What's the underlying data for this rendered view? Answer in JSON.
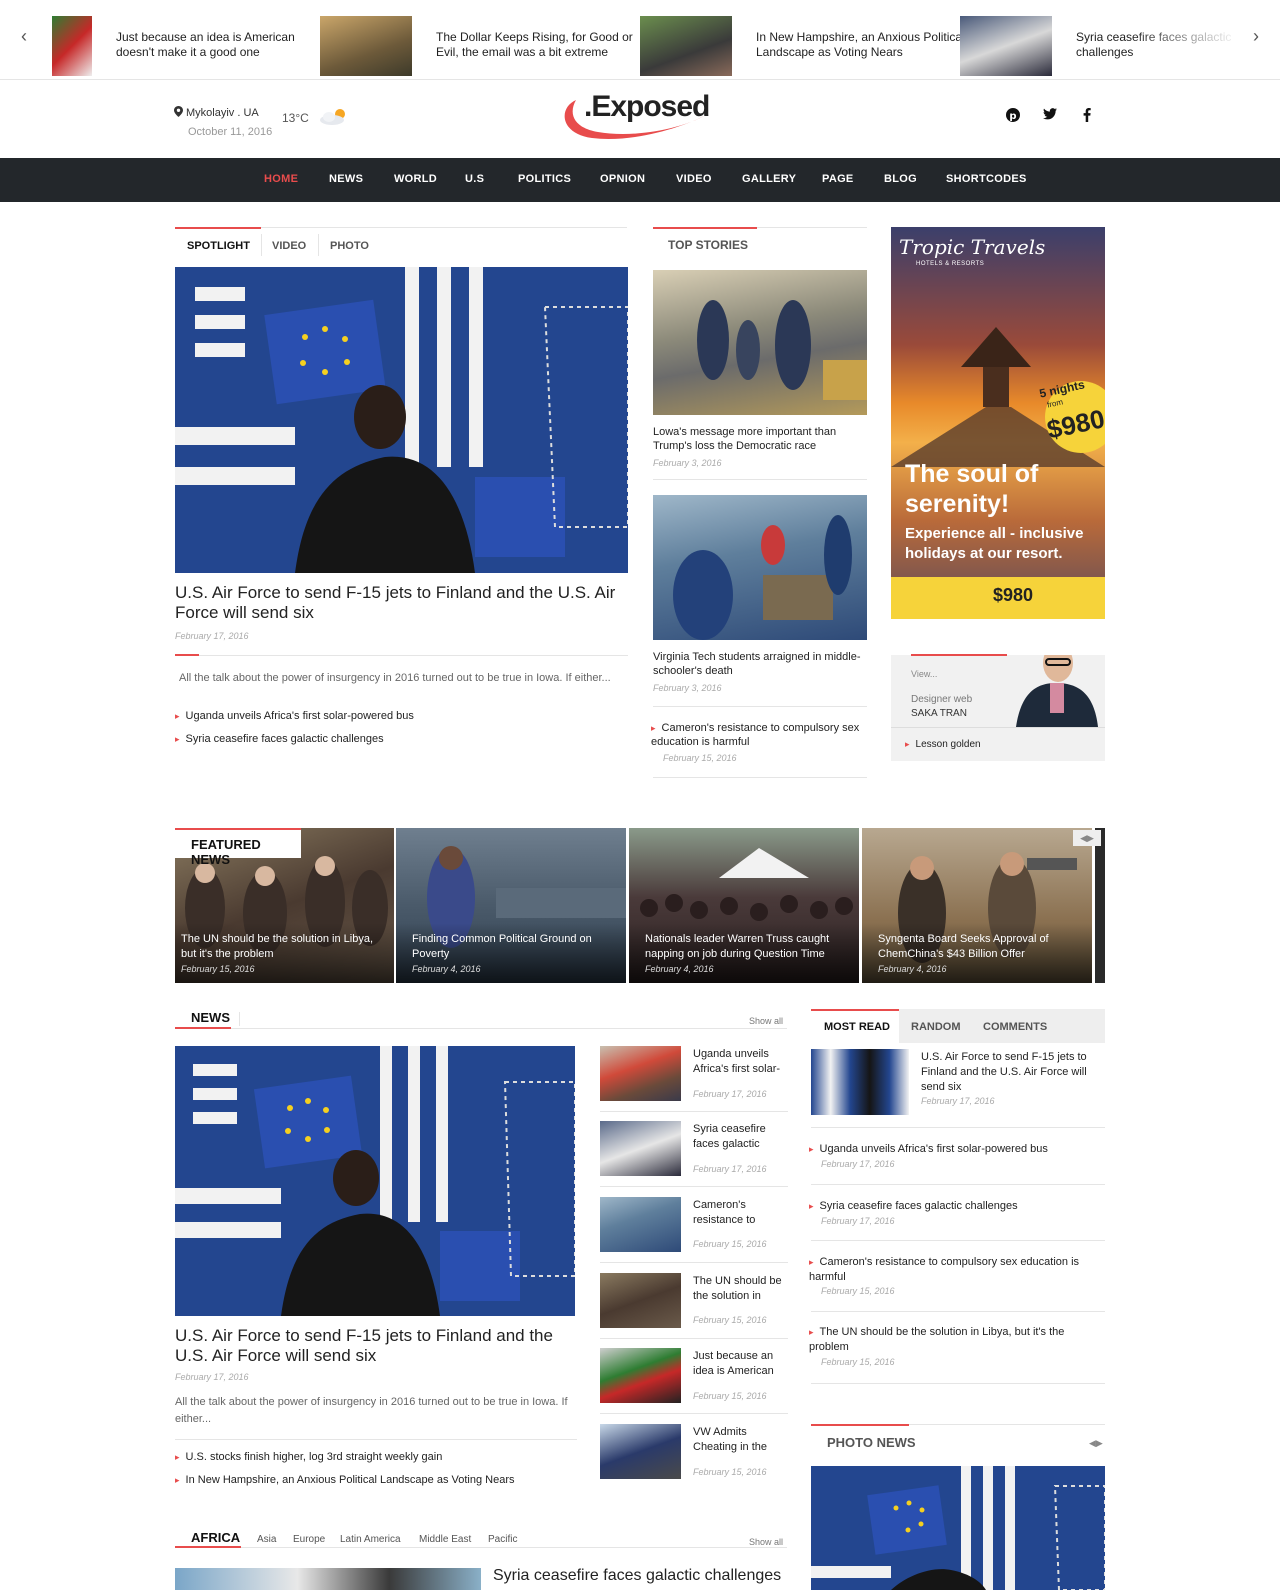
{
  "ticker": {
    "items": [
      {
        "text": "Just because an idea is American doesn't make it a good one"
      },
      {
        "text": "The Dollar Keeps Rising, for Good or Evil, the email was a bit extreme"
      },
      {
        "text": "In New Hampshire, an Anxious Political Landscape as Voting Nears"
      },
      {
        "text": "Syria ceasefire faces galactic challenges"
      }
    ]
  },
  "header": {
    "location": "Mykolayiv . UA",
    "date": "October 11, 2016",
    "temperature": "13°C",
    "logo": ".Exposed",
    "social": [
      "P",
      "t",
      "f"
    ]
  },
  "nav": {
    "items": [
      "HOME",
      "NEWS",
      "WORLD",
      "U.S",
      "POLITICS",
      "OPNION",
      "VIDEO",
      "GALLERY",
      "PAGE",
      "BLOG",
      "SHORTCODES"
    ]
  },
  "spotlight": {
    "tabs": [
      "SPOTLIGHT",
      "VIDEO",
      "PHOTO"
    ],
    "title": "U.S. Air Force to send F-15 jets to Finland and the U.S. Air Force will send six",
    "date": "February 17, 2016",
    "excerpt": "All the talk about the power of insurgency in 2016 turned out to be true in Iowa. If either...",
    "links": [
      "Uganda unveils Africa's first solar-powered bus",
      "Syria ceasefire faces galactic challenges"
    ]
  },
  "top_stories": {
    "heading": "TOP STORIES",
    "items": [
      {
        "title": "Lowa's message more important than Trump's loss the Democratic race",
        "date": "February 3, 2016"
      },
      {
        "title": "Virginia Tech students arraigned in middle-schooler's death",
        "date": "February 3, 2016"
      },
      {
        "title": "Cameron's resistance to compulsory sex education is harmful",
        "date": "February 15, 2016"
      }
    ]
  },
  "ad": {
    "brand": "Tropic Travels",
    "brand_sub": "HOTELS & RESORTS",
    "nights": "5 nights",
    "from": "from",
    "price": "$980",
    "headline": "The soul of serenity!",
    "sub": "Experience all - inclusive holidays at our resort.",
    "footer_price": "$980"
  },
  "profile": {
    "view": "View...",
    "role": "Designer web",
    "name": "SAKA TRAN",
    "link": "Lesson golden"
  },
  "featured": {
    "heading": "FEATURED NEWS",
    "items": [
      {
        "title": "The UN should be the solution in Libya, but it's the problem",
        "date": "February 15, 2016"
      },
      {
        "title": "Finding Common Political Ground on Poverty",
        "date": "February 4, 2016"
      },
      {
        "title": "Nationals leader Warren Truss caught napping on job during Question Time",
        "date": "February 4, 2016"
      },
      {
        "title": "Syngenta Board Seeks Approval of ChemChina's $43 Billion Offer",
        "date": "February 4, 2016"
      }
    ]
  },
  "news": {
    "heading": "NEWS",
    "show_all": "Show all",
    "title": "U.S. Air Force to send F-15 jets to Finland and the U.S. Air Force will send six",
    "date": "February 17, 2016",
    "excerpt": "All the talk about the power of insurgency in 2016 turned out to be true in Iowa. If either...",
    "links": [
      "U.S. stocks finish higher, log 3rd straight weekly gain",
      "In New Hampshire, an Anxious Political Landscape as Voting Nears"
    ],
    "side": [
      {
        "title": "Uganda unveils Africa's first solar-",
        "date": "February 17, 2016"
      },
      {
        "title": "Syria ceasefire faces galactic",
        "date": "February 17, 2016"
      },
      {
        "title": "Cameron's resistance to",
        "date": "February 15, 2016"
      },
      {
        "title": "The UN should be the solution in",
        "date": "February 15, 2016"
      },
      {
        "title": "Just because an idea is American",
        "date": "February 15, 2016"
      },
      {
        "title": "VW Admits Cheating in the",
        "date": "February 15, 2016"
      }
    ]
  },
  "most_read": {
    "tabs": [
      "MOST READ",
      "RANDOM",
      "COMMENTS"
    ],
    "top": {
      "title": "U.S. Air Force to send F-15 jets to Finland and the U.S. Air Force will send six",
      "date": "February 17, 2016"
    },
    "items": [
      {
        "title": "Uganda unveils Africa's first solar-powered bus",
        "date": "February 17, 2016"
      },
      {
        "title": "Syria ceasefire faces galactic challenges",
        "date": "February 17, 2016"
      },
      {
        "title": "Cameron's resistance to compulsory sex education is harmful",
        "date": "February 15, 2016"
      },
      {
        "title": "The UN should be the solution in Libya, but it's the problem",
        "date": "February 15, 2016"
      }
    ]
  },
  "photo_news": {
    "heading": "PHOTO NEWS"
  },
  "africa": {
    "tabs": [
      "AFRICA",
      "Asia",
      "Europe",
      "Latin America",
      "Middle East",
      "Pacific"
    ],
    "show_all": "Show all",
    "title": "Syria ceasefire faces galactic challenges"
  },
  "colors": {
    "accent": "#e84c4c",
    "nav_bg": "#23272b"
  }
}
